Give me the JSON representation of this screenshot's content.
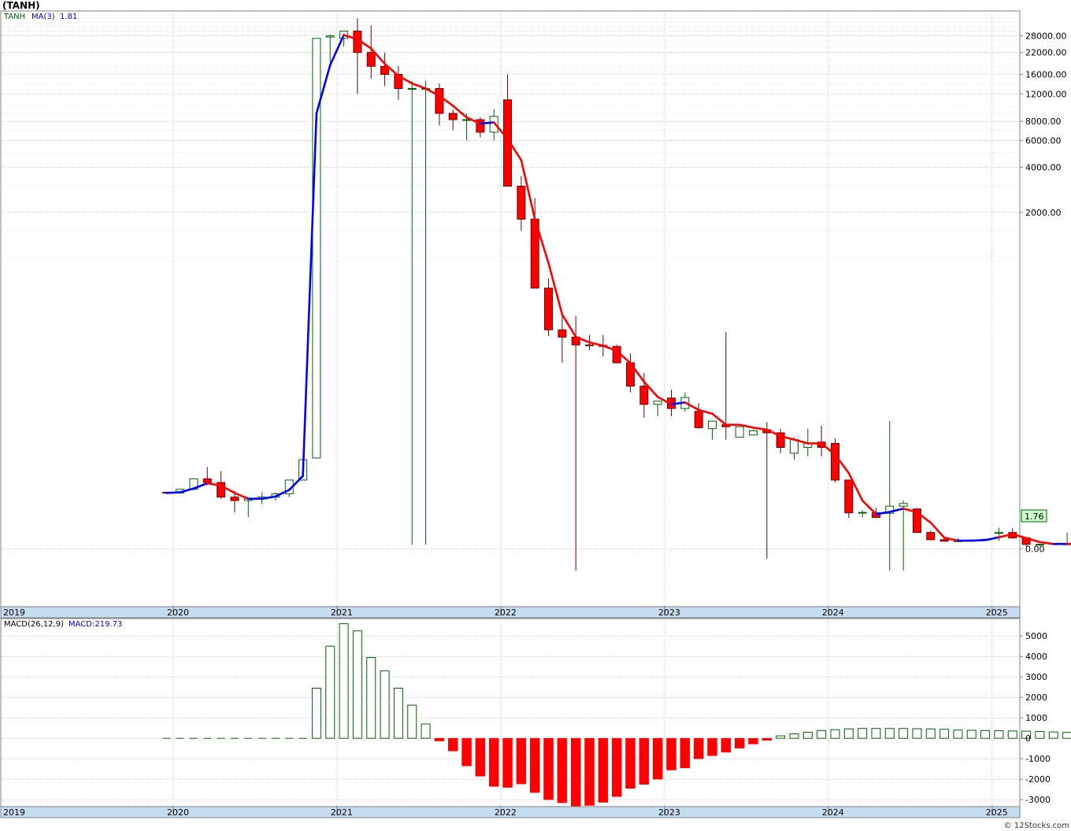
{
  "title": "(TANH)",
  "watermark": "© 12Stocks.com",
  "colors": {
    "up": "#006400",
    "down": "#ff0000",
    "ma_up": "#0000ff",
    "ma_down": "#ff0000",
    "grid": "#bfbfbf",
    "last_price_bg": "#ccffcc",
    "year_band": "#c6dcef",
    "macd_text": "#0000ff"
  },
  "price_panel": {
    "ticker_label": "TANH",
    "ma_label": "MA(3)",
    "ma_value": "1.81",
    "last_price": "1.76",
    "y_ticks": [
      "28000.00",
      "22000.00",
      "16000.00",
      "12000.00",
      "8000.00",
      "6000.00",
      "4000.00",
      "2000.00",
      "0.00"
    ],
    "year_labels": [
      "2019",
      "2020",
      "2021",
      "2022",
      "2023",
      "2024",
      "2025"
    ]
  },
  "macd_panel": {
    "label": "MACD(26,12,9)",
    "value_label": "MACD:219.73",
    "y_ticks": [
      "5000",
      "4000",
      "3000",
      "2000",
      "1000",
      "0",
      "-1000",
      "-2000",
      "-3000"
    ],
    "year_labels": [
      "2019",
      "2020",
      "2021",
      "2022",
      "2023",
      "2024",
      "2025"
    ]
  },
  "chart_data": [
    {
      "type": "candlestick",
      "title": "(TANH)",
      "scale": "compressed-log",
      "interval": "monthly",
      "x": [
        "2019-12",
        "2020-01",
        "2020-02",
        "2020-03",
        "2020-04",
        "2020-05",
        "2020-06",
        "2020-07",
        "2020-08",
        "2020-09",
        "2020-10",
        "2020-11",
        "2020-12",
        "2021-01",
        "2021-02",
        "2021-03",
        "2021-04",
        "2021-05",
        "2021-06",
        "2021-07",
        "2021-08",
        "2021-09",
        "2021-10",
        "2021-11",
        "2021-12",
        "2022-01",
        "2022-02",
        "2022-03",
        "2022-04",
        "2022-05",
        "2022-06",
        "2022-07",
        "2022-08",
        "2022-09",
        "2022-10",
        "2022-11",
        "2022-12",
        "2023-01",
        "2023-02",
        "2023-03",
        "2023-04",
        "2023-05",
        "2023-06",
        "2023-07",
        "2023-08",
        "2023-09",
        "2023-10",
        "2023-11",
        "2023-12",
        "2024-01",
        "2024-02",
        "2024-03",
        "2024-04",
        "2024-05",
        "2024-06",
        "2024-07",
        "2024-08",
        "2024-09",
        "2024-10",
        "2024-11",
        "2024-12",
        "2025-01",
        "2025-02",
        "2025-03",
        "2025-04",
        "2025-05",
        "2025-06",
        "2025-07",
        "2025-08",
        "2025-09"
      ],
      "open": [
        11.5,
        11.3,
        12.5,
        16.5,
        15,
        10,
        9,
        9.5,
        10,
        11,
        16,
        27,
        27500,
        27000,
        30000,
        22000,
        18000,
        16000,
        13000,
        13000,
        13000,
        9000,
        8200,
        8200,
        6800,
        11000,
        3000,
        1800,
        600,
        300,
        265,
        232,
        230,
        226,
        170,
        112,
        80,
        90,
        74,
        70,
        50,
        54,
        42,
        44,
        49,
        46,
        30,
        34,
        38,
        37,
        16,
        5.9,
        5.9,
        5.8,
        7.5,
        6.8,
        2.2,
        1.15,
        0.95,
        1.0,
        1.1,
        2.1,
        2.2,
        1.4,
        0.55,
        0.55,
        0.6,
        0.62,
        0.58,
        1.2
      ],
      "high": [
        11.6,
        11.6,
        15,
        22,
        20,
        12,
        9.8,
        11.5,
        11.5,
        13,
        21,
        28,
        28500,
        30000,
        36000,
        32500,
        22000,
        18000,
        14500,
        14500,
        14000,
        9500,
        9000,
        8500,
        9600,
        16000,
        3500,
        2500,
        700,
        380,
        380,
        275,
        275,
        232,
        200,
        142,
        82,
        105,
        100,
        82,
        53,
        290,
        45,
        49,
        57,
        50,
        42,
        50,
        53,
        41,
        16,
        6.5,
        7,
        58,
        9,
        7,
        2.5,
        1.3,
        1.4,
        1.2,
        1.3,
        3,
        2.9,
        1.5,
        0.56,
        0.68,
        2.2,
        0.72,
        0.62,
        2.1
      ],
      "low": [
        11.1,
        11.0,
        12.2,
        14,
        9.5,
        6,
        5,
        8,
        9,
        10,
        16,
        27,
        19000,
        24000,
        12000,
        15000,
        13500,
        11000,
        0.5,
        0.5,
        7500,
        7000,
        6000,
        6300,
        6000,
        4000,
        1500,
        1500,
        270,
        170,
        -2,
        212,
        190,
        168,
        100,
        62,
        64,
        64,
        70,
        50,
        40,
        40,
        42,
        44,
        -1,
        30,
        26,
        28,
        28,
        15,
        4.8,
        4.9,
        5,
        -2,
        -2,
        5.8,
        1.1,
        0.95,
        0.9,
        0.95,
        1.0,
        1.0,
        1.3,
        0.3,
        0.3,
        0.5,
        0.5,
        0.5,
        0.3,
        0.4
      ],
      "close": [
        11.3,
        12.5,
        16.5,
        15,
        10,
        9,
        9.5,
        10,
        11,
        16,
        26,
        27000,
        28000,
        30000,
        22000,
        18000,
        16000,
        13000,
        13000,
        13000,
        9000,
        8200,
        8200,
        6800,
        8600,
        3000,
        1800,
        600,
        300,
        265,
        232,
        230,
        226,
        170,
        112,
        80,
        85,
        74,
        91,
        51,
        58,
        52,
        52,
        48,
        46,
        34,
        40,
        37,
        34,
        16,
        5.9,
        6.0,
        4.9,
        7.5,
        8.2,
        2.2,
        1.15,
        0.95,
        1.0,
        1.1,
        1.2,
        2.2,
        1.4,
        0.55,
        0.57,
        0.65,
        0.6,
        0.62,
        0.5,
        1.76
      ]
    },
    {
      "type": "line",
      "title": "MA(3)",
      "x": [
        "2019-12",
        "2020-01",
        "2020-02",
        "2020-03",
        "2020-04",
        "2020-05",
        "2020-06",
        "2020-07",
        "2020-08",
        "2020-09",
        "2020-10",
        "2020-11",
        "2020-12",
        "2021-01",
        "2021-02",
        "2021-03",
        "2021-04",
        "2021-05",
        "2021-06",
        "2021-07",
        "2021-08",
        "2021-09",
        "2021-10",
        "2021-11",
        "2021-12",
        "2022-01",
        "2022-02",
        "2022-03",
        "2022-04",
        "2022-05",
        "2022-06",
        "2022-07",
        "2022-08",
        "2022-09",
        "2022-10",
        "2022-11",
        "2022-12",
        "2023-01",
        "2023-02",
        "2023-03",
        "2023-04",
        "2023-05",
        "2023-06",
        "2023-07",
        "2023-08",
        "2023-09",
        "2023-10",
        "2023-11",
        "2023-12",
        "2024-01",
        "2024-02",
        "2024-03",
        "2024-04",
        "2024-05",
        "2024-06",
        "2024-07",
        "2024-08",
        "2024-09",
        "2024-10",
        "2024-11",
        "2024-12",
        "2025-01",
        "2025-02",
        "2025-03",
        "2025-04",
        "2025-05",
        "2025-06",
        "2025-07",
        "2025-08",
        "2025-09"
      ],
      "values": [
        11.3,
        11.5,
        12.8,
        14.7,
        13.8,
        11.3,
        9.5,
        9.5,
        10.2,
        12.3,
        17.7,
        9014,
        18342,
        28333,
        26667,
        23333,
        18667,
        15667,
        14000,
        13000,
        11667,
        10067,
        8467,
        7733,
        7867,
        6133,
        4467,
        1800,
        900,
        388,
        266,
        242,
        229,
        209,
        169,
        121,
        92,
        80,
        83,
        72,
        67,
        54,
        54,
        51,
        49,
        43,
        40,
        37,
        37,
        29,
        19,
        9,
        5.6,
        6.1,
        6.9,
        6.0,
        3.9,
        1.43,
        1.03,
        1.02,
        1.1,
        1.5,
        1.93,
        1.38,
        0.84,
        0.59,
        0.61,
        0.62,
        0.57,
        1.81
      ],
      "rising": [
        true,
        true,
        true,
        true,
        false,
        false,
        false,
        true,
        true,
        true,
        true,
        true,
        true,
        true,
        false,
        false,
        false,
        false,
        false,
        false,
        false,
        false,
        false,
        false,
        true,
        false,
        false,
        false,
        false,
        false,
        false,
        false,
        false,
        false,
        false,
        false,
        false,
        false,
        true,
        false,
        false,
        false,
        false,
        false,
        false,
        false,
        false,
        false,
        false,
        false,
        false,
        false,
        false,
        true,
        true,
        false,
        false,
        false,
        false,
        true,
        true,
        true,
        false,
        false,
        false,
        false,
        true,
        false,
        false,
        false
      ]
    },
    {
      "type": "bar",
      "title": "MACD(26,12,9)",
      "x": [
        "2019-12",
        "2020-01",
        "2020-02",
        "2020-03",
        "2020-04",
        "2020-05",
        "2020-06",
        "2020-07",
        "2020-08",
        "2020-09",
        "2020-10",
        "2020-11",
        "2020-12",
        "2021-01",
        "2021-02",
        "2021-03",
        "2021-04",
        "2021-05",
        "2021-06",
        "2021-07",
        "2021-08",
        "2021-09",
        "2021-10",
        "2021-11",
        "2021-12",
        "2022-01",
        "2022-02",
        "2022-03",
        "2022-04",
        "2022-05",
        "2022-06",
        "2022-07",
        "2022-08",
        "2022-09",
        "2022-10",
        "2022-11",
        "2022-12",
        "2023-01",
        "2023-02",
        "2023-03",
        "2023-04",
        "2023-05",
        "2023-06",
        "2023-07",
        "2023-08",
        "2023-09",
        "2023-10",
        "2023-11",
        "2023-12",
        "2024-01",
        "2024-02",
        "2024-03",
        "2024-04",
        "2024-05",
        "2024-06",
        "2024-07",
        "2024-08",
        "2024-09",
        "2024-10",
        "2024-11",
        "2024-12",
        "2025-01",
        "2025-02",
        "2025-03",
        "2025-04",
        "2025-05",
        "2025-06",
        "2025-07",
        "2025-08",
        "2025-09"
      ],
      "values": [
        0,
        0,
        0,
        0,
        0,
        0,
        0,
        0,
        0,
        0,
        0,
        2450,
        4500,
        5600,
        5250,
        3950,
        3300,
        2450,
        1620,
        700,
        -130,
        -620,
        -1350,
        -1850,
        -2350,
        -2400,
        -2230,
        -2650,
        -3000,
        -3150,
        -3350,
        -3280,
        -3130,
        -2850,
        -2450,
        -2250,
        -2000,
        -1550,
        -1450,
        -1000,
        -850,
        -680,
        -480,
        -280,
        -100,
        120,
        220,
        300,
        380,
        420,
        460,
        480,
        480,
        480,
        480,
        470,
        460,
        440,
        400,
        390,
        380,
        370,
        360,
        350,
        330,
        310,
        290,
        270,
        250,
        220
      ],
      "ylim": [
        -3300,
        5700
      ]
    }
  ]
}
